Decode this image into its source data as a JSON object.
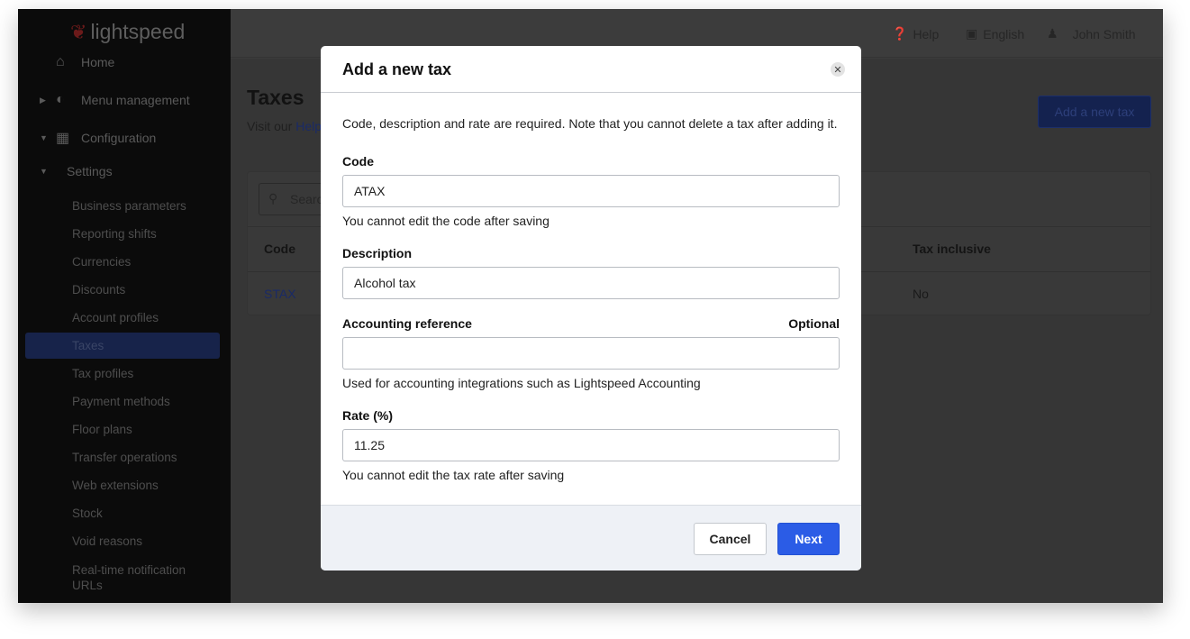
{
  "brand": "lightspeed",
  "sidebar": {
    "items": [
      {
        "label": "Home",
        "icon": "home-icon"
      },
      {
        "label": "Menu management",
        "icon": "menu-icon"
      },
      {
        "label": "Configuration",
        "icon": "grid-icon"
      }
    ],
    "settings_label": "Settings",
    "settings": [
      "Business parameters",
      "Reporting shifts",
      "Currencies",
      "Discounts",
      "Account profiles",
      "Taxes",
      "Tax profiles",
      "Payment methods",
      "Floor plans",
      "Transfer operations",
      "Web extensions",
      "Stock",
      "Void reasons",
      "Real-time notification URLs"
    ],
    "active": "Taxes"
  },
  "topbar": {
    "help": "Help",
    "language": "English",
    "user": "John Smith"
  },
  "page": {
    "title": "Taxes",
    "visit_prefix": "Visit our",
    "visit_link": "Help",
    "add_button": "Add a new tax",
    "search_placeholder": "Search",
    "columns": [
      "Code",
      "Tax inclusive"
    ],
    "rows": [
      {
        "code": "STAX",
        "tax_inclusive": "No"
      }
    ]
  },
  "modal": {
    "title": "Add a new tax",
    "intro": "Code, description and rate are required. Note that you cannot delete a tax after adding it.",
    "code": {
      "label": "Code",
      "value": "ATAX",
      "help": "You cannot edit the code after saving"
    },
    "description": {
      "label": "Description",
      "value": "Alcohol tax"
    },
    "accounting": {
      "label": "Accounting reference",
      "optional": "Optional",
      "value": "",
      "help": "Used for accounting integrations such as Lightspeed Accounting"
    },
    "rate": {
      "label": "Rate (%)",
      "value": "11.25",
      "help": "You cannot edit the tax rate after saving"
    },
    "cancel": "Cancel",
    "next": "Next"
  },
  "colors": {
    "primary": "#2b5ce6"
  }
}
